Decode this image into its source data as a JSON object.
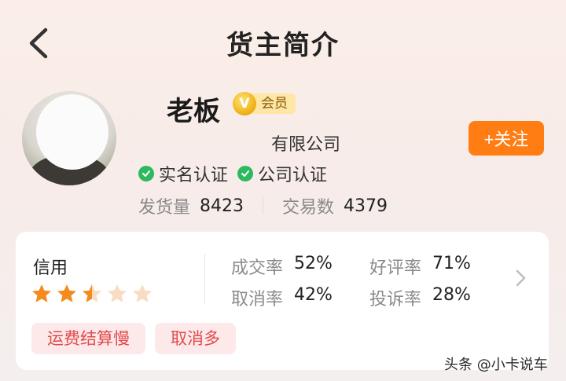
{
  "header": {
    "title": "货主简介"
  },
  "profile": {
    "name": "老板",
    "vip_badge": "会员",
    "vip_icon": "V",
    "company": "有限公司",
    "certifications": [
      "实名认证",
      "公司认证"
    ],
    "shipments_label": "发货量",
    "shipments_value": "8423",
    "trades_label": "交易数",
    "trades_value": "4379",
    "follow_label": "+关注"
  },
  "credit": {
    "title": "信用",
    "rating": 2.5,
    "max_rating": 5,
    "deal_rate_label": "成交率",
    "deal_rate_value": "52%",
    "good_review_label": "好评率",
    "good_review_value": "71%",
    "cancel_rate_label": "取消率",
    "cancel_rate_value": "42%",
    "complaint_rate_label": "投诉率",
    "complaint_rate_value": "28%",
    "tags": [
      "运费结算慢",
      "取消多"
    ]
  },
  "watermark": "头条 @小卡说车",
  "colors": {
    "accent": "#ff7d13",
    "star": "#f58b1f",
    "star_empty": "#f9dcc1",
    "check": "#2fb95e",
    "tag_text": "#e04b4b",
    "tag_bg": "#fde9ea"
  }
}
